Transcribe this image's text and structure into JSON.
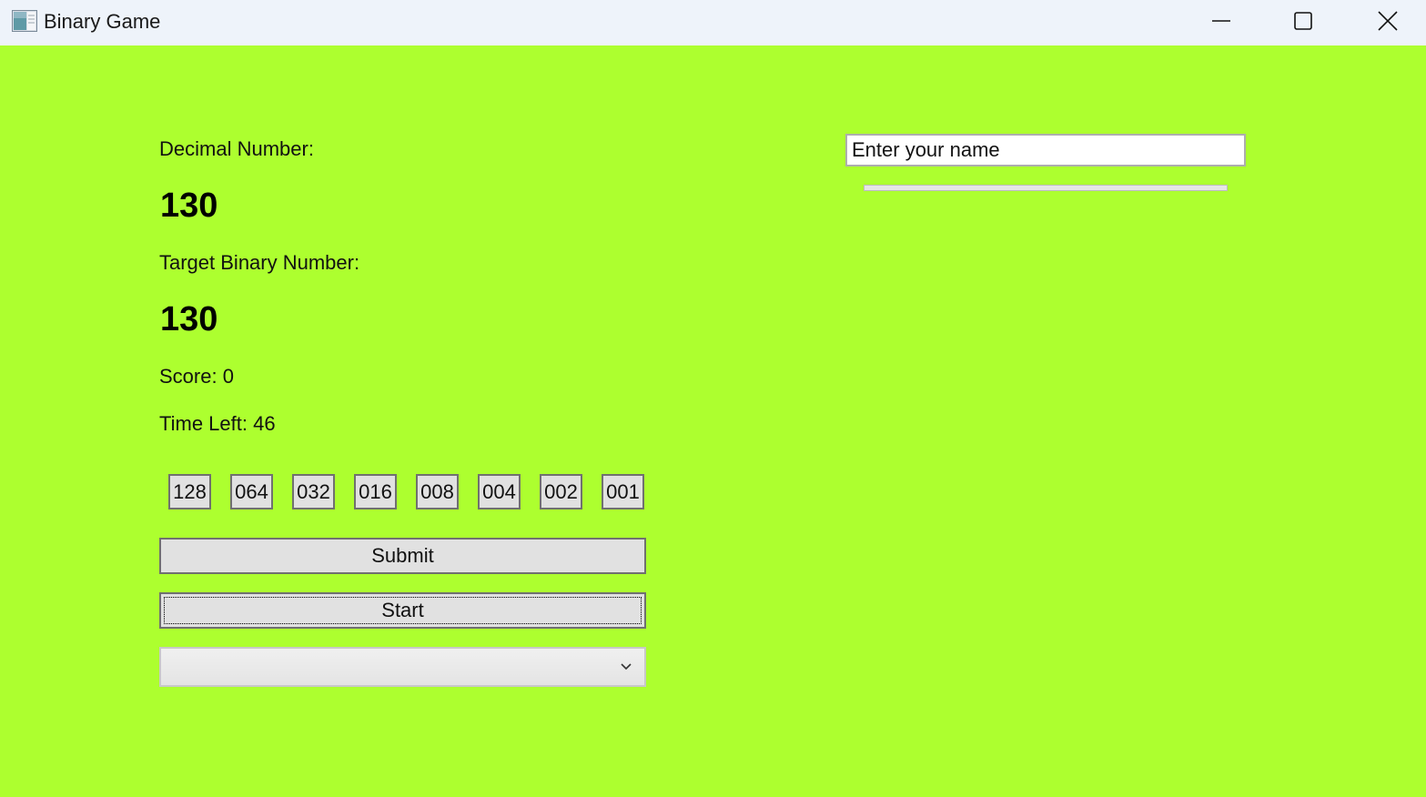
{
  "window": {
    "title": "Binary Game",
    "icon": "app-icon",
    "controls": [
      "minimize-icon",
      "maximize-icon",
      "close-icon"
    ]
  },
  "game": {
    "decimal_label": "Decimal Number:",
    "decimal_value": "130",
    "target_label": "Target Binary Number:",
    "target_value": "130",
    "score_text": "Score: 0",
    "time_text": "Time Left: 46",
    "bits": [
      "128",
      "064",
      "032",
      "016",
      "008",
      "004",
      "002",
      "001"
    ],
    "submit_label": "Submit",
    "start_label": "Start",
    "combo_value": ""
  },
  "player": {
    "name_placeholder": "Enter your name",
    "progress": 0
  },
  "colors": {
    "background": "#adff2f",
    "titlebar": "#eef3fa"
  }
}
